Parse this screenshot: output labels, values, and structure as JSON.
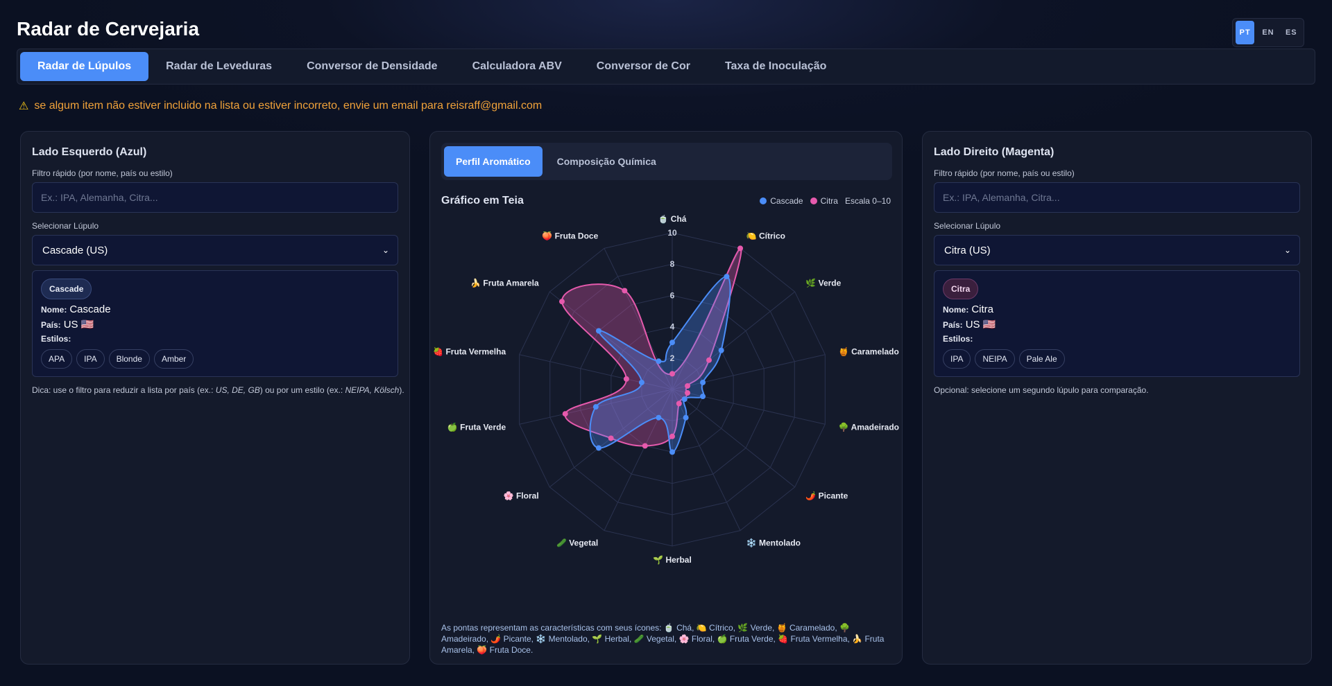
{
  "app": {
    "title": "Radar de Cervejaria",
    "languages": [
      "PT",
      "EN",
      "ES"
    ],
    "active_language": "PT"
  },
  "nav": {
    "tabs": [
      "Radar de Lúpulos",
      "Radar de Leveduras",
      "Conversor de Densidade",
      "Calculadora ABV",
      "Conversor de Cor",
      "Taxa de Inoculação"
    ],
    "active_tab": "Radar de Lúpulos"
  },
  "warning": {
    "icon": "warning-icon",
    "text": "se algum item não estiver incluido na lista ou estiver incorreto, envie um email para reisraff@gmail.com"
  },
  "left": {
    "title": "Lado Esquerdo (Azul)",
    "filter_label": "Filtro rápido (por nome, país ou estilo)",
    "filter_placeholder": "Ex.: IPA, Alemanha, Citra...",
    "select_label": "Selecionar Lúpulo",
    "selected": "Cascade (US)",
    "chip": "Cascade",
    "name_label": "Nome:",
    "name": "Cascade",
    "country_label": "País:",
    "country": "US 🇺🇸",
    "styles_label": "Estilos:",
    "styles": [
      "APA",
      "IPA",
      "Blonde",
      "Amber"
    ],
    "hint_prefix": "Dica: use o filtro para reduzir a lista por país (ex.: ",
    "hint_countries": "US, DE, GB",
    "hint_middle": ") ou por um estilo (ex.: ",
    "hint_styles": "NEIPA, Kölsch",
    "hint_suffix": ")."
  },
  "right": {
    "title": "Lado Direito (Magenta)",
    "filter_label": "Filtro rápido (por nome, país ou estilo)",
    "filter_placeholder": "Ex.: IPA, Alemanha, Citra...",
    "select_label": "Selecionar Lúpulo",
    "selected": "Citra (US)",
    "chip": "Citra",
    "name_label": "Nome:",
    "name": "Citra",
    "country_label": "País:",
    "country": "US 🇺🇸",
    "styles_label": "Estilos:",
    "styles": [
      "IPA",
      "NEIPA",
      "Pale Ale"
    ],
    "hint": "Opcional: selecione um segundo lúpulo para comparação."
  },
  "center": {
    "tabs": [
      "Perfil Aromático",
      "Composição Química"
    ],
    "active_tab": "Perfil Aromático",
    "chart_title": "Gráfico em Teia",
    "legend": [
      {
        "name": "Cascade",
        "color": "#4b8df8"
      },
      {
        "name": "Citra",
        "color": "#e65aad"
      }
    ],
    "scale_label": "Escala 0–10",
    "footnote": "As pontas representam as características com seus ícones: 🍵 Chá, 🍋 Cítrico, 🌿 Verde, 🍯 Caramelado, 🌳 Amadeirado, 🌶️ Picante, ❄️ Mentolado, 🌱 Herbal, 🥒 Vegetal, 🌸 Floral, 🍏 Fruta Verde, 🍓 Fruta Vermelha, 🍌 Fruta Amarela, 🍑 Fruta Doce."
  },
  "chart_data": {
    "type": "radar",
    "title": "Gráfico em Teia",
    "scale": [
      0,
      10
    ],
    "ticks": [
      2,
      4,
      6,
      8,
      10
    ],
    "categories": [
      {
        "label": "Chá",
        "icon": "🍵"
      },
      {
        "label": "Cítrico",
        "icon": "🍋"
      },
      {
        "label": "Verde",
        "icon": "🌿"
      },
      {
        "label": "Caramelado",
        "icon": "🍯"
      },
      {
        "label": "Amadeirado",
        "icon": "🌳"
      },
      {
        "label": "Picante",
        "icon": "🌶️"
      },
      {
        "label": "Mentolado",
        "icon": "❄️"
      },
      {
        "label": "Herbal",
        "icon": "🌱"
      },
      {
        "label": "Vegetal",
        "icon": "🥒"
      },
      {
        "label": "Floral",
        "icon": "🌸"
      },
      {
        "label": "Fruta Verde",
        "icon": "🍏"
      },
      {
        "label": "Fruta Vermelha",
        "icon": "🍓"
      },
      {
        "label": "Fruta Amarela",
        "icon": "🍌"
      },
      {
        "label": "Fruta Doce",
        "icon": "🍑"
      }
    ],
    "series": [
      {
        "name": "Cascade",
        "color": "#4b8df8",
        "values": [
          3,
          8,
          4,
          2,
          2,
          1,
          2,
          4,
          2,
          6,
          5,
          2,
          6,
          2
        ]
      },
      {
        "name": "Citra",
        "color": "#e65aad",
        "values": [
          1,
          10,
          3,
          1,
          1,
          1,
          1,
          3,
          4,
          5,
          7,
          3,
          9,
          7
        ]
      }
    ]
  }
}
